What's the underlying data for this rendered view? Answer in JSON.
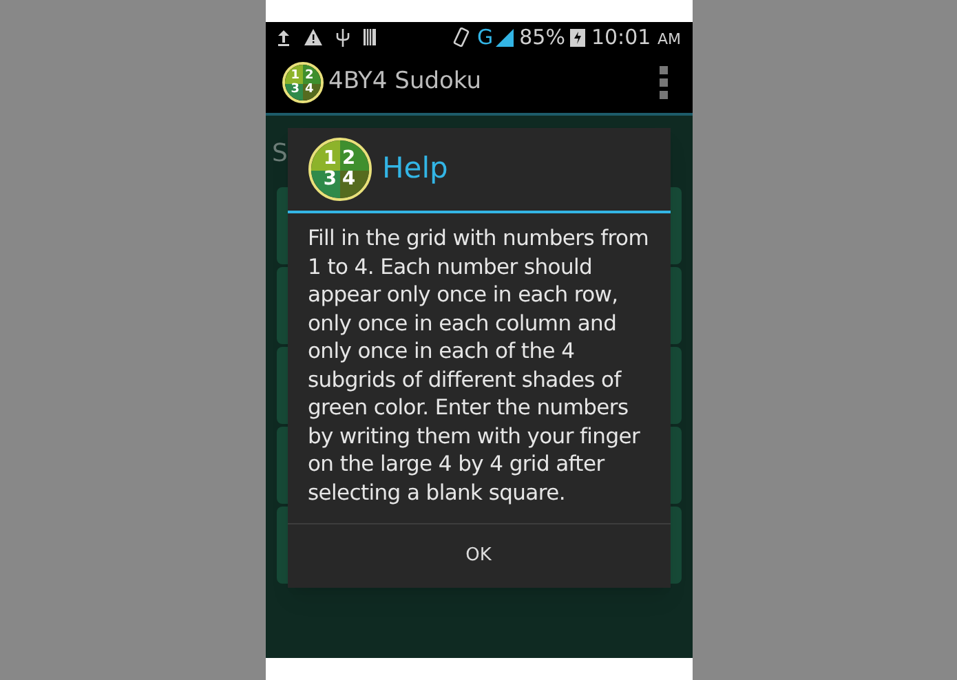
{
  "status_bar": {
    "network": "G",
    "battery": "85%",
    "time": "10:01",
    "ampm": "AM"
  },
  "app_bar": {
    "logo_digits": [
      "1",
      "2",
      "3",
      "4"
    ],
    "title": "4BY4 Sudoku"
  },
  "background": {
    "heading": "S"
  },
  "dialog": {
    "logo_digits": [
      "1",
      "2",
      "3",
      "4"
    ],
    "title": "Help",
    "message": "Fill in the grid with numbers from 1 to 4. Each number should appear only once in each row, only once in each column and only once in each of the 4 subgrids of different shades of green color. Enter the numbers by writing them with your finger on the large 4 by 4 grid after selecting a blank square.",
    "buttons": [
      "OK"
    ]
  }
}
